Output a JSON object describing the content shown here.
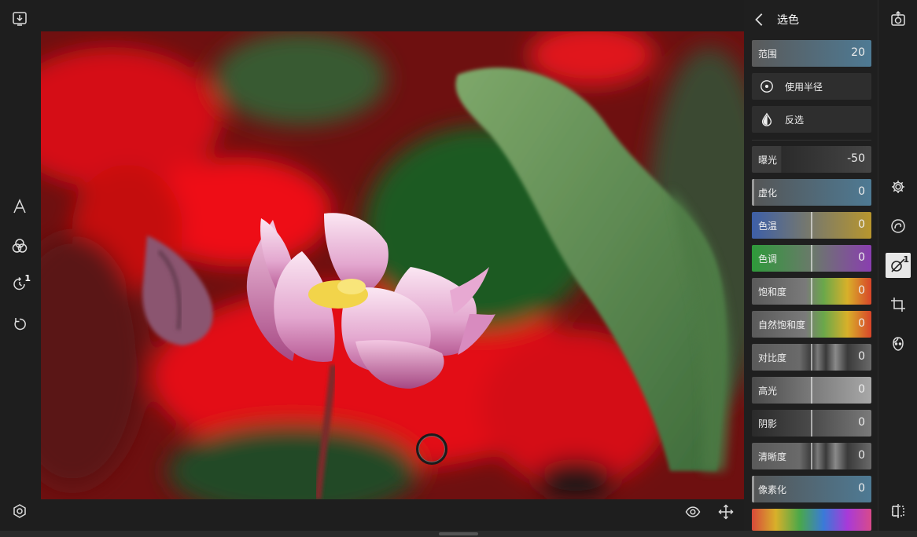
{
  "panel": {
    "title": "选色",
    "range": {
      "label": "范围",
      "value": "20"
    },
    "use_radius": {
      "label": "使用半径"
    },
    "invert": {
      "label": "反选"
    },
    "sliders": [
      {
        "label": "曝光",
        "value": "-50"
      },
      {
        "label": "虚化",
        "value": "0"
      },
      {
        "label": "色温",
        "value": "0"
      },
      {
        "label": "色调",
        "value": "0"
      },
      {
        "label": "饱和度",
        "value": "0"
      },
      {
        "label": "自然饱和度",
        "value": "0"
      },
      {
        "label": "对比度",
        "value": "0"
      },
      {
        "label": "高光",
        "value": "0"
      },
      {
        "label": "阴影",
        "value": "0"
      },
      {
        "label": "清晰度",
        "value": "0"
      },
      {
        "label": "像素化",
        "value": "0"
      }
    ]
  },
  "left_toolbar": {
    "icons": [
      "save-icon",
      "text-icon",
      "blend-icon",
      "history-icon",
      "undo-icon",
      "settings-hex-icon"
    ],
    "history_badge": "1"
  },
  "right_toolbar": {
    "icons": [
      "export-icon",
      "gear-icon",
      "spiral-icon",
      "selective-edit-icon",
      "crop-icon",
      "face-icon",
      "compare-icon"
    ],
    "selective_badge": "1"
  },
  "bottom_toolbar": {
    "icons": [
      "eye-icon",
      "move-icon"
    ]
  }
}
